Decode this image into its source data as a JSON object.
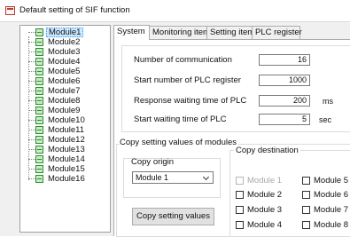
{
  "window": {
    "title": "Default setting of SIF function",
    "icon": "app-window-icon"
  },
  "tree": {
    "items": [
      {
        "label": "Module1",
        "selected": true
      },
      {
        "label": "Module2"
      },
      {
        "label": "Module3"
      },
      {
        "label": "Module4"
      },
      {
        "label": "Module5"
      },
      {
        "label": "Module6"
      },
      {
        "label": "Module7"
      },
      {
        "label": "Module8"
      },
      {
        "label": "Module9"
      },
      {
        "label": "Module10"
      },
      {
        "label": "Module11"
      },
      {
        "label": "Module12"
      },
      {
        "label": "Module13"
      },
      {
        "label": "Module14"
      },
      {
        "label": "Module15"
      },
      {
        "label": "Module16"
      }
    ],
    "node_icon": "module-node-icon"
  },
  "tabs": [
    {
      "label": "System",
      "active": true
    },
    {
      "label": "Monitoring item"
    },
    {
      "label": "Setting item"
    },
    {
      "label": "PLC register"
    }
  ],
  "system": {
    "fields": [
      {
        "label": "Number of communication",
        "value": "16",
        "unit": ""
      },
      {
        "label": "Start number of PLC register",
        "value": "1000",
        "unit": ""
      },
      {
        "label": "Response waiting time of PLC",
        "value": "200",
        "unit": "ms"
      },
      {
        "label": "Start waiting time of PLC",
        "value": "5",
        "unit": "sec"
      }
    ],
    "copy": {
      "section_title": "Copy setting values of modules",
      "origin_label": "Copy origin",
      "origin_value": "Module 1",
      "destination_label": "Copy destination",
      "button_label": "Copy setting values",
      "destinations": [
        {
          "label": "Module 1",
          "disabled": true
        },
        {
          "label": "Module 2"
        },
        {
          "label": "Module 3"
        },
        {
          "label": "Module 4"
        },
        {
          "label": "Module 5"
        },
        {
          "label": "Module 6"
        },
        {
          "label": "Module 7"
        },
        {
          "label": "Module 8"
        }
      ]
    }
  },
  "colors": {
    "selection": "#cce8ff",
    "node_icon": "#2e8b2e",
    "title_icon": "#c0392b"
  }
}
